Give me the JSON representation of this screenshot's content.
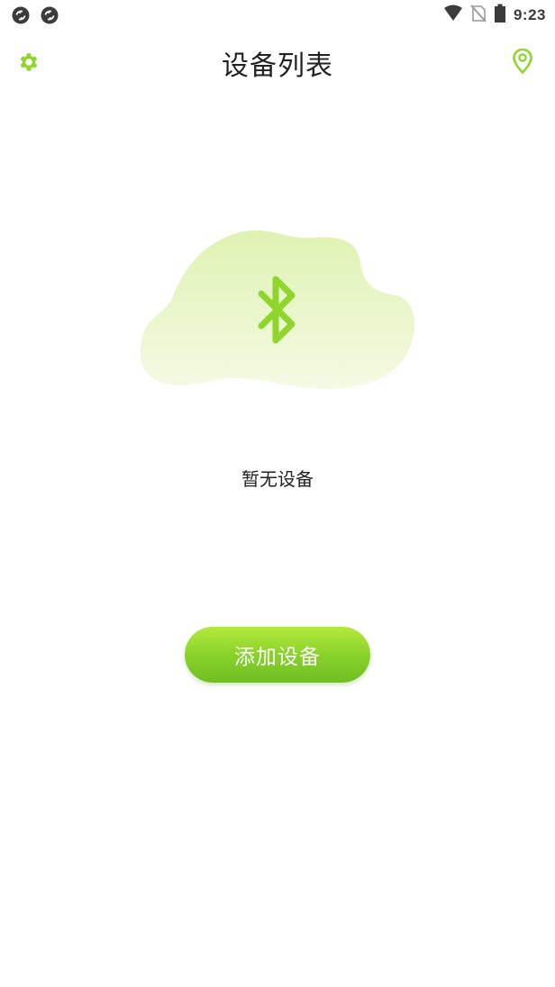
{
  "status_bar": {
    "time": "9:23",
    "icons": [
      "sync-icon",
      "sync-icon",
      "wifi-icon",
      "no-sim-icon",
      "battery-icon"
    ]
  },
  "header": {
    "title": "设备列表",
    "left_icon": "gear-icon",
    "right_icon": "location-pin-icon"
  },
  "empty_state": {
    "icon": "bluetooth-icon",
    "message": "暂无设备"
  },
  "actions": {
    "add_device_label": "添加设备"
  },
  "colors": {
    "accent": "#8fd62c",
    "accent_dark": "#6fbe22",
    "blob_light": "#f3f9e4",
    "blob_top": "#dff2b2",
    "text": "#222222",
    "status_icon": "#3b3b3b"
  }
}
